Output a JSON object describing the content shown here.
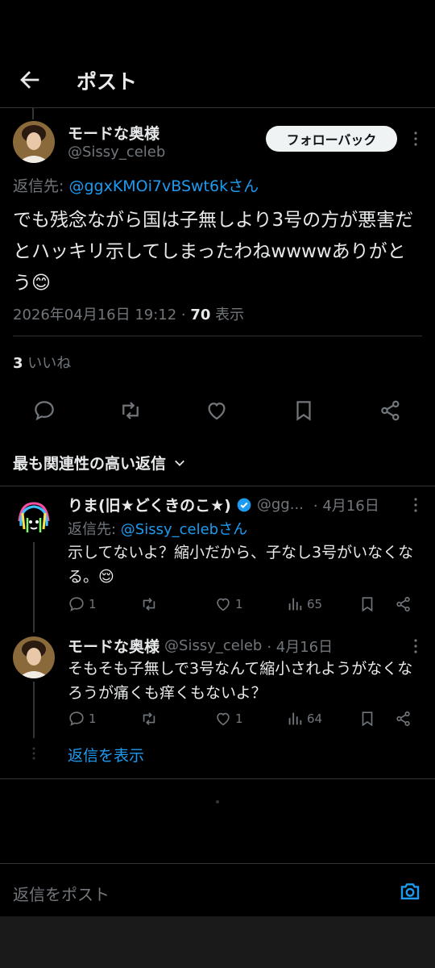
{
  "header": {
    "title": "ポスト"
  },
  "post": {
    "author_name": "モードな奥様",
    "author_handle": "@Sissy_celeb",
    "follow_label": "フォローバック",
    "reply_to_prefix": "返信先: ",
    "reply_to_handle": "@ggxKMOi7vBSwt6kさん",
    "text": "でも残念ながら国は子無しより3号の方が悪害だとハッキリ示してしまったわねwwwwありがとう😊",
    "timestamp": "2026年04月16日 19:12 · ",
    "views_count": "70",
    "views_label": " 表示",
    "likes_count": "3",
    "likes_label": " いいね"
  },
  "sort": {
    "label": "最も関連性の高い返信"
  },
  "replies": [
    {
      "name": "りま(旧★どくきのこ★)",
      "handle": "@gg...",
      "date": "· 4月16日",
      "reply_to_prefix": "返信先: ",
      "reply_to_handle": "@Sissy_celebさん",
      "text": "示してないよ？縮小だから、子なし3号がいなくなる。😌",
      "replies": "1",
      "likes": "1",
      "views": "65"
    },
    {
      "name": "モードな奥様",
      "handle": "@Sissy_celeb",
      "date": "· 4月16日",
      "text": "そもそも子無しで3号なんて縮小されようがなくなろうが痛くも痒くもないよ？",
      "replies": "1",
      "likes": "1",
      "views": "64"
    }
  ],
  "show_replies": {
    "label": "返信を表示"
  },
  "compose": {
    "placeholder": "返信をポスト"
  },
  "colors": {
    "accent": "#1d9bf0",
    "background": "#000000",
    "muted": "#71767b",
    "verified": "#1d9bf0"
  },
  "icons": [
    "back-arrow-icon",
    "more-icon",
    "reply-icon",
    "repost-icon",
    "like-icon",
    "bookmark-icon",
    "share-icon",
    "views-icon",
    "chevron-down-icon",
    "verified-icon",
    "camera-icon"
  ]
}
